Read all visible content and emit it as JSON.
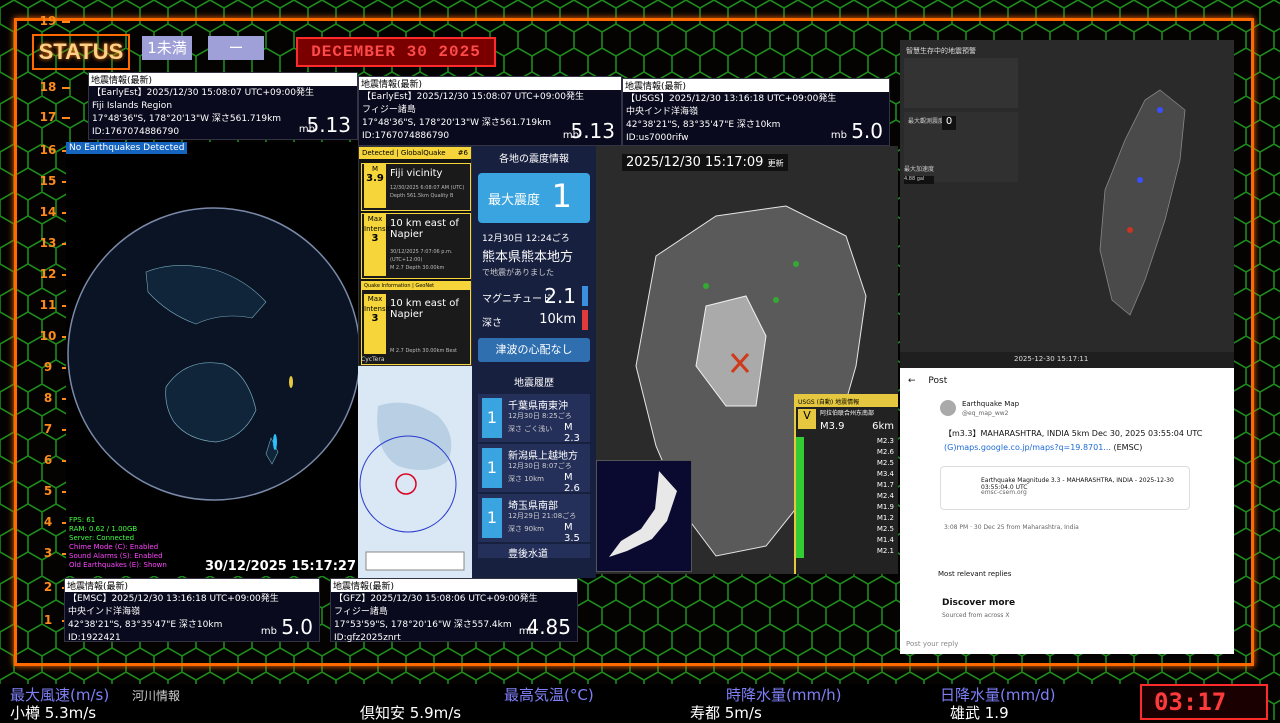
{
  "status_label": "STATUS",
  "pill_1": "1未満",
  "pill_2": "ー",
  "date_banner": "DECEMBER 30 2025",
  "ruler": [
    "19",
    "18",
    "17",
    "16",
    "15",
    "14",
    "13",
    "12",
    "11",
    "10",
    "9",
    "8",
    "7",
    "6",
    "5",
    "4",
    "3",
    "2",
    "1"
  ],
  "info_boxes": [
    {
      "header": "地震情報(最新)",
      "line1": "【EarlyEst】2025/12/30 15:08:07 UTC+09:00発生",
      "line2": "Fiji Islands Region",
      "line3": "17°48'36\"S, 178°20'13\"W 深さ561.719km",
      "line4": "ID:1767074886790",
      "mb": "mb",
      "mag": "5.13"
    },
    {
      "header": "地震情報(最新)",
      "line1": "【EarlyEst】2025/12/30 15:08:07 UTC+09:00発生",
      "line2": "フィジー諸島",
      "line3": "17°48'36\"S, 178°20'13\"W 深さ561.719km",
      "line4": "ID:1767074886790",
      "mb": "mb",
      "mag": "5.13"
    },
    {
      "header": "地震情報(最新)",
      "line1": "【USGS】2025/12/30 13:16:18 UTC+09:00発生",
      "line2": "中央インド洋海嶺",
      "line3": "42°38'21\"S, 83°35'47\"E 深さ10km",
      "line4": "ID:us7000rifw",
      "mb": "mb",
      "mag": "5.0"
    },
    {
      "header": "地震情報(最新)",
      "line1": "【EMSC】2025/12/30 13:16:18 UTC+09:00発生",
      "line2": "中央インド洋海嶺",
      "line3": "42°38'21\"S, 83°35'47\"E 深さ10km",
      "line4": "ID:1922421",
      "mb": "mb",
      "mag": "5.0"
    },
    {
      "header": "地震情報(最新)",
      "line1": "【GFZ】2025/12/30 15:08:06 UTC+09:00発生",
      "line2": "フィジー諸島",
      "line3": "17°53'59\"S, 178°20'16\"W 深さ557.4km",
      "line4": "ID:gfz2025znrt",
      "mb": "mb",
      "mag": "4.85"
    }
  ],
  "globe": {
    "no_eq": "No Earthquakes Detected",
    "stats": [
      "FPS: 61",
      "RAM: 0.62 / 1.00GB",
      "Server: Connected",
      "Chime Mode (C): Enabled",
      "Sound Alarms (S): Enabled",
      "Old Earthquakes (E): Shown"
    ],
    "timestamp": "30/12/2025 15:17:27"
  },
  "gq": {
    "header": "Detected | GlobalQuake",
    "header_no": "#6",
    "cards": [
      {
        "int_label": "M",
        "int_val": "3.9",
        "title": "Fiji vicinity",
        "meta": "12/30/2025 6:08:07 AM (UTC)",
        "meta2": "Depth 561.5km  Quality B"
      },
      {
        "int_label": "Max Intensity",
        "int_val": "3",
        "title": "10 km east of Napier",
        "meta": "30/12/2025 7:07:06 p.m. (UTC+12:00)",
        "meta2": "M 2.7  Depth 30.00km"
      },
      {
        "int_label": "Max Intensity",
        "int_val": "3",
        "title": "10 km east of Napier",
        "meta": "Quake Information | GeoNet",
        "meta2": "M 2.7  Depth 30.00km  Best"
      }
    ],
    "footer": "CycTera"
  },
  "jma": {
    "title": "各地の震度情報",
    "max_label": "最大震度",
    "max_val": "1",
    "time": "12月30日 12:24ごろ",
    "region": "熊本県熊本地方",
    "occurred": "で地震がありました",
    "mag_label": "マグニチュード",
    "mag_val": "2.1",
    "depth_label": "深さ",
    "depth_val": "10km",
    "tsunami": "津波の心配なし",
    "history_title": "地震履歴",
    "history": [
      {
        "int": "1",
        "place": "千葉県南東沖",
        "time": "12月30日 8:25ごろ",
        "depth": "深さ ごく浅い",
        "mag": "M 2.3"
      },
      {
        "int": "1",
        "place": "新潟県上越地方",
        "time": "12月30日 8:07ごろ",
        "depth": "深さ 10km",
        "mag": "M 2.6"
      },
      {
        "int": "1",
        "place": "埼玉県南部",
        "time": "12月29日 21:08ごろ",
        "depth": "深さ 90km",
        "mag": "M 3.5"
      },
      {
        "int": "",
        "place": "豊後水道",
        "time": "",
        "depth": "",
        "mag": ""
      }
    ]
  },
  "jmap": {
    "time": "2025/12/30 15:17:09",
    "update": "更新",
    "usgs_title": "USGS (自動) 地震情報",
    "usgs_int": "V",
    "usgs_place": "阿拉伯联合州东南部",
    "usgs_mag": "M3.9",
    "usgs_depth": "6km",
    "list": [
      "M2.3",
      "M2.6",
      "M2.5",
      "M3.4",
      "M1.7",
      "M2.4",
      "M1.9",
      "M1.2",
      "M2.5",
      "M1.4",
      "M2.1"
    ]
  },
  "tw": {
    "title": "智慧生存中的地震預警",
    "label_max": "最大觀測震度",
    "zero": "0",
    "label_acc": "最大加速度",
    "acc": "4.88 gal",
    "status_time": "2025-12-30 15:17:11"
  },
  "x_post": {
    "post_label": "Post",
    "account": "Earthquake Map",
    "handle": "@eq_map_ww2",
    "text": "【m3.3】MAHARASHTRA, INDIA 5km Dec 30, 2025 03:55:04 UTC",
    "link": "(G)maps.google.co.jp/maps?q=19.8701...",
    "emsc": "(EMSC)",
    "card_title": "Earthquake Magnitude 3.3 - MAHARASHTRA, INDIA - 2025-12-30 03:55:04.0 UTC",
    "card_domain": "emsc-csem.org",
    "meta": "3:08 PM · 30 Dec 25 from Maharashtra, India",
    "relevant": "Most relevant replies",
    "discover": "Discover more",
    "sourced": "Sourced from across X",
    "reply": "Post your reply"
  },
  "ticker": {
    "row1": [
      "最大風速(m/s)",
      "河川情報",
      "最高気温(°C)",
      "時降水量(mm/h)",
      "日降水量(mm/d)"
    ],
    "row2": [
      "小樽 5.3m/s",
      "倶知安 5.9m/s",
      "寿都 5m/s",
      "雄武 1.9"
    ]
  },
  "clock": "03:17"
}
